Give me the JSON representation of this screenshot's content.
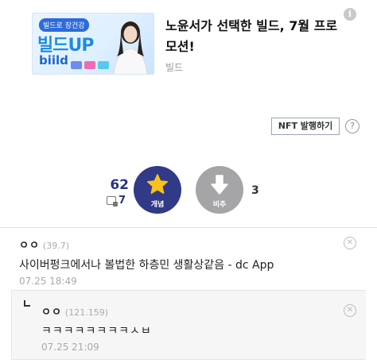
{
  "ad": {
    "banner_tag": "빌드로 장건강",
    "banner_headline": "빌드UP",
    "banner_brand": "biild",
    "title": "노윤서가 선택한 빌드, 7월 프로모션!",
    "source": "빌드",
    "info_glyph": "i"
  },
  "nft": {
    "button_label": "NFT 발행하기",
    "help_glyph": "?"
  },
  "votes": {
    "up_count": "62",
    "fix_count": "7",
    "up_label": "개념",
    "down_label": "비추",
    "down_count": "3",
    "up_color": "#303a87",
    "down_color": "#a5a5a7",
    "star_color": "#f7c21b"
  },
  "comments": [
    {
      "nick": "ㅇㅇ",
      "ip": "(39.7)",
      "text": "사이버펑크에서나 볼법한 하층민 생활상같음 - dc App",
      "time": "07.25 18:49"
    }
  ],
  "replies": [
    {
      "nick": "ㅇㅇ",
      "ip": "(121.159)",
      "text": "ㅋㅋㅋㅋㅋㅋㅋㅋㅅㅂ",
      "time": "07.25 21:09"
    }
  ],
  "delete_glyph": "✕"
}
